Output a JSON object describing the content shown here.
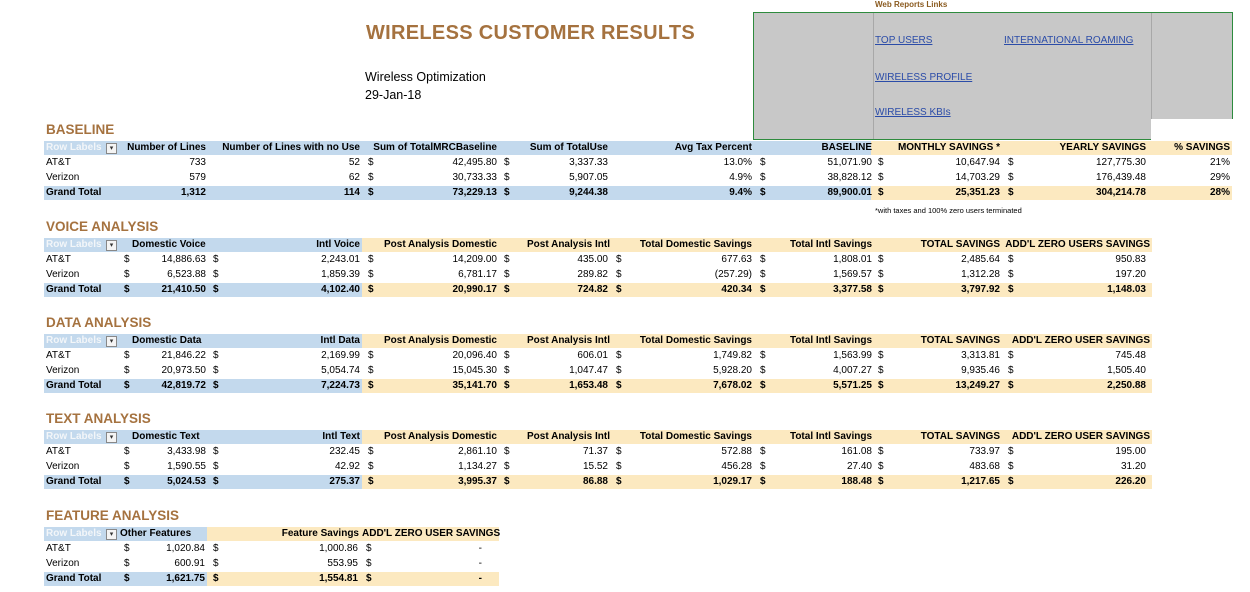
{
  "header": {
    "title": "WIRELESS CUSTOMER RESULTS",
    "subtitle": "Wireless Optimization",
    "date": "29-Jan-18"
  },
  "web_links": {
    "label": "Web Reports Links",
    "top_users": "TOP USERS",
    "international_roaming": "INTERNATIONAL ROAMING",
    "wireless_profile": "WIRELESS PROFILE",
    "wireless_kbis": "WIRELESS KBIs"
  },
  "row_labels": "Row Labels",
  "baseline": {
    "title": "BASELINE",
    "headers": [
      "Row Labels",
      "Number of Lines",
      "Number of Lines with no Use",
      "Sum of TotalMRCBaseline",
      "Sum of TotalUse",
      "Avg Tax Percent",
      "BASELINE",
      "MONTHLY SAVINGS *",
      "YEARLY SAVINGS",
      "% SAVINGS"
    ],
    "rows": [
      [
        "AT&T",
        "733",
        "52",
        "$",
        "42,495.80",
        "$",
        "3,337.33",
        "13.0%",
        "$",
        "51,071.90",
        "$",
        "10,647.94",
        "$",
        "127,775.30",
        "21%"
      ],
      [
        "Verizon",
        "579",
        "62",
        "$",
        "30,733.33",
        "$",
        "5,907.05",
        "4.9%",
        "$",
        "38,828.12",
        "$",
        "14,703.29",
        "$",
        "176,439.48",
        "29%"
      ],
      [
        "Grand Total",
        "1,312",
        "114",
        "$",
        "73,229.13",
        "$",
        "9,244.38",
        "9.4%",
        "$",
        "89,900.01",
        "$",
        "25,351.23",
        "$",
        "304,214.78",
        "28%"
      ]
    ],
    "note": "*with taxes and 100% zero users terminated"
  },
  "voice": {
    "title": "VOICE ANALYSIS",
    "headers": [
      "Row Labels",
      "Domestic Voice",
      "Intl Voice",
      "Post Analysis Domestic",
      "Post Analysis Intl",
      "Total Domestic Savings",
      "Total Intl Savings",
      "TOTAL SAVINGS",
      "ADD'L ZERO USERS SAVINGS"
    ],
    "rows": [
      [
        "AT&T",
        "$",
        "14,886.63",
        "$",
        "2,243.01",
        "$",
        "14,209.00",
        "$",
        "435.00",
        "$",
        "677.63",
        "$",
        "1,808.01",
        "$",
        "2,485.64",
        "$",
        "950.83"
      ],
      [
        "Verizon",
        "$",
        "6,523.88",
        "$",
        "1,859.39",
        "$",
        "6,781.17",
        "$",
        "289.82",
        "$",
        "(257.29)",
        "$",
        "1,569.57",
        "$",
        "1,312.28",
        "$",
        "197.20"
      ],
      [
        "Grand Total",
        "$",
        "21,410.50",
        "$",
        "4,102.40",
        "$",
        "20,990.17",
        "$",
        "724.82",
        "$",
        "420.34",
        "$",
        "3,377.58",
        "$",
        "3,797.92",
        "$",
        "1,148.03"
      ]
    ]
  },
  "data": {
    "title": "DATA ANALYSIS",
    "headers": [
      "Row Labels",
      "Domestic Data",
      "Intl Data",
      "Post Analysis Domestic",
      "Post Analysis Intl",
      "Total Domestic Savings",
      "Total Intl Savings",
      "TOTAL SAVINGS",
      "ADD'L ZERO USER SAVINGS"
    ],
    "rows": [
      [
        "AT&T",
        "$",
        "21,846.22",
        "$",
        "2,169.99",
        "$",
        "20,096.40",
        "$",
        "606.01",
        "$",
        "1,749.82",
        "$",
        "1,563.99",
        "$",
        "3,313.81",
        "$",
        "745.48"
      ],
      [
        "Verizon",
        "$",
        "20,973.50",
        "$",
        "5,054.74",
        "$",
        "15,045.30",
        "$",
        "1,047.47",
        "$",
        "5,928.20",
        "$",
        "4,007.27",
        "$",
        "9,935.46",
        "$",
        "1,505.40"
      ],
      [
        "Grand Total",
        "$",
        "42,819.72",
        "$",
        "7,224.73",
        "$",
        "35,141.70",
        "$",
        "1,653.48",
        "$",
        "7,678.02",
        "$",
        "5,571.25",
        "$",
        "13,249.27",
        "$",
        "2,250.88"
      ]
    ]
  },
  "text": {
    "title": "TEXT ANALYSIS",
    "headers": [
      "Row Labels",
      "Domestic Text",
      "Intl Text",
      "Post Analysis Domestic",
      "Post Analysis Intl",
      "Total Domestic Savings",
      "Total Intl Savings",
      "TOTAL SAVINGS",
      "ADD'L ZERO USER SAVINGS"
    ],
    "rows": [
      [
        "AT&T",
        "$",
        "3,433.98",
        "$",
        "232.45",
        "$",
        "2,861.10",
        "$",
        "71.37",
        "$",
        "572.88",
        "$",
        "161.08",
        "$",
        "733.97",
        "$",
        "195.00"
      ],
      [
        "Verizon",
        "$",
        "1,590.55",
        "$",
        "42.92",
        "$",
        "1,134.27",
        "$",
        "15.52",
        "$",
        "456.28",
        "$",
        "27.40",
        "$",
        "483.68",
        "$",
        "31.20"
      ],
      [
        "Grand Total",
        "$",
        "5,024.53",
        "$",
        "275.37",
        "$",
        "3,995.37",
        "$",
        "86.88",
        "$",
        "1,029.17",
        "$",
        "188.48",
        "$",
        "1,217.65",
        "$",
        "226.20"
      ]
    ]
  },
  "feature": {
    "title": "FEATURE ANALYSIS",
    "headers": [
      "Row Labels",
      "Other Features",
      "Feature Savings",
      "ADD'L ZERO USER SAVINGS"
    ],
    "rows": [
      [
        "AT&T",
        "$",
        "1,020.84",
        "$",
        "1,000.86",
        "$",
        "-"
      ],
      [
        "Verizon",
        "$",
        "600.91",
        "$",
        "553.95",
        "$",
        "-"
      ],
      [
        "Grand Total",
        "$",
        "1,621.75",
        "$",
        "1,554.81",
        "$",
        "-"
      ]
    ]
  }
}
